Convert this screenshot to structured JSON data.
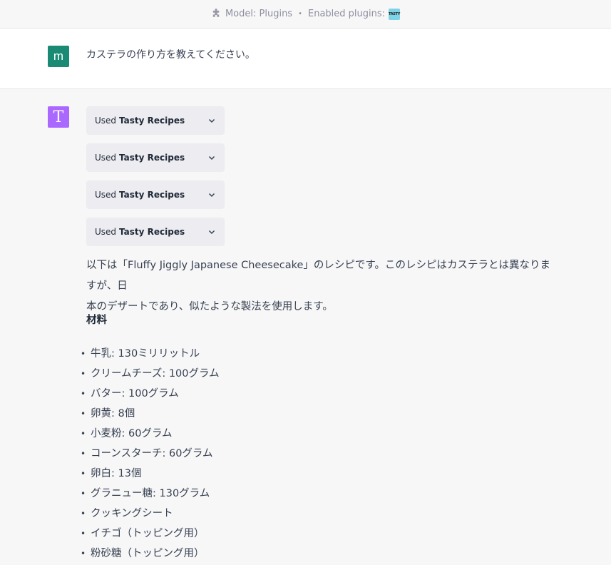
{
  "header": {
    "model_label": "Model: Plugins",
    "separator": "•",
    "enabled_label": "Enabled plugins:",
    "plugin_logo_text": "TASTY",
    "icon": "puzzle-icon"
  },
  "user_message": {
    "avatar_letter": "m",
    "text": "カステラの作り方を教えてください。",
    "avatar_color": "#1a8a74"
  },
  "assistant": {
    "avatar_letter": "T",
    "avatar_color": "#ab68ff",
    "plugin_calls": [
      {
        "used": "Used",
        "name": "Tasty Recipes"
      },
      {
        "used": "Used",
        "name": "Tasty Recipes"
      },
      {
        "used": "Used",
        "name": "Tasty Recipes"
      },
      {
        "used": "Used",
        "name": "Tasty Recipes"
      }
    ],
    "intro_line1": "以下は「Fluffy Jiggly Japanese Cheesecake」のレシピです。このレシピはカステラとは異なりますが、日",
    "intro_line2": "本のデザートであり、似たような製法を使用します。",
    "section_title": "材料",
    "ingredients": [
      "牛乳: 130ミリリットル",
      "クリームチーズ: 100グラム",
      "バター: 100グラム",
      "卵黄: 8個",
      "小麦粉: 60グラム",
      "コーンスターチ: 60グラム",
      "卵白: 13個",
      "グラニュー糖: 130グラム",
      "クッキングシート",
      "イチゴ（トッピング用）",
      "粉砂糖（トッピング用）"
    ]
  }
}
